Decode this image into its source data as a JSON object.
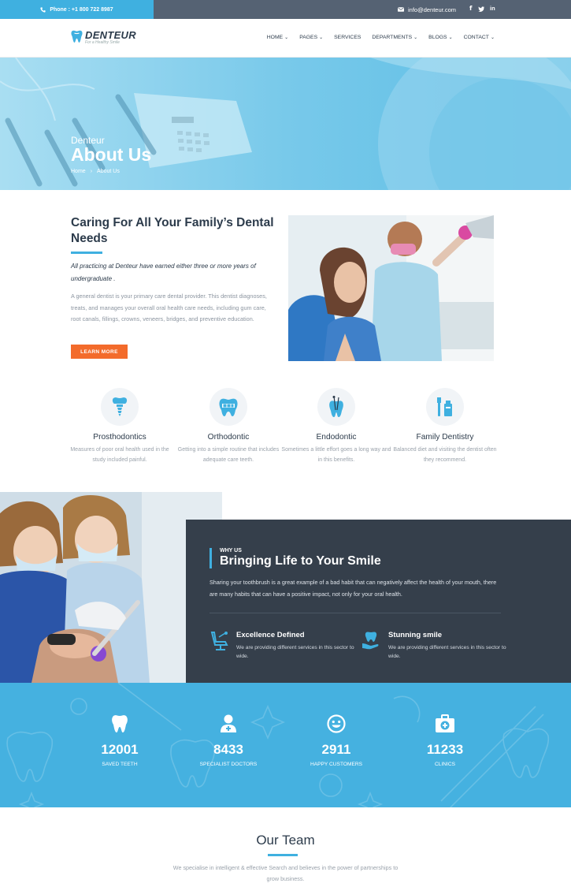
{
  "topbar": {
    "phone": "Phone : +1 800 722 8987",
    "email": "info@denteur.com",
    "socials": [
      "facebook-icon",
      "twitter-icon",
      "linkedin-icon"
    ]
  },
  "brand": {
    "name": "DENTEUR",
    "tagline": "For a Healthy Smile"
  },
  "nav": [
    {
      "label": "HOME",
      "dropdown": true
    },
    {
      "label": "PAGES",
      "dropdown": true
    },
    {
      "label": "SERVICES",
      "dropdown": false
    },
    {
      "label": "DEPARTMENTS",
      "dropdown": true
    },
    {
      "label": "BLOGS",
      "dropdown": true
    },
    {
      "label": "CONTACT",
      "dropdown": true
    }
  ],
  "hero": {
    "subtitle": "Denteur",
    "title": "About Us",
    "breadcrumb": [
      "Home",
      "About Us"
    ],
    "separator": "›"
  },
  "about": {
    "heading": "Caring For All Your Family’s Dental Needs",
    "lead": "All practicing at Denteur have earned either three or more years of undergraduate .",
    "body": "A general dentist is your primary care dental provider. This dentist diagnoses, treats, and manages your overall oral health care needs, including gum care, root canals, fillings, crowns, veneers, bridges, and preventive education.",
    "button": "LEARN MORE"
  },
  "services": [
    {
      "icon": "dental-implant-icon",
      "name": "Prosthodontics",
      "desc": "Measures of poor oral health used in the study included painful."
    },
    {
      "icon": "tooth-braces-icon",
      "name": "Orthodontic",
      "desc": "Getting into a simple routine that includes adequate care teeth."
    },
    {
      "icon": "dental-tools-icon",
      "name": "Endodontic",
      "desc": "Sometimes a little effort goes a long way and in this benefits."
    },
    {
      "icon": "toothpaste-icon",
      "name": "Family Dentistry",
      "desc": "Balanced diet and visiting the dentist often they recommend."
    }
  ],
  "why": {
    "tag": "WHY US",
    "title": "Bringing Life to Your Smile",
    "body": "Sharing your toothbrush is a great example of a bad habit that can negatively affect the health of your mouth, there are many habits that can have a positive impact, not only for your oral health.",
    "features": [
      {
        "icon": "dental-chair-icon",
        "title": "Excellence Defined",
        "desc": "We are providing different services in this sector to wide."
      },
      {
        "icon": "tooth-hand-icon",
        "title": "Stunning smile",
        "desc": "We are providing different services in this sector to wide."
      }
    ]
  },
  "stats": [
    {
      "icon": "tooth-icon",
      "value": "12001",
      "label": "SAVED TEETH"
    },
    {
      "icon": "doctor-icon",
      "value": "8433",
      "label": "SPECIALIST DOCTORS"
    },
    {
      "icon": "smile-icon",
      "value": "2911",
      "label": "HAPPY CUSTOMERS"
    },
    {
      "icon": "first-aid-kit-icon",
      "value": "11233",
      "label": "CLINICS"
    }
  ],
  "team": {
    "title": "Our Team",
    "subtitle": "We specialise in intelligent & effective Search and believes in the power of partnerships to grow business."
  },
  "colors": {
    "accent": "#3fb0e0",
    "dark": "#353f4b",
    "topbar": "#556273",
    "orange": "#f36b2b",
    "heading": "#2c3b4b"
  }
}
